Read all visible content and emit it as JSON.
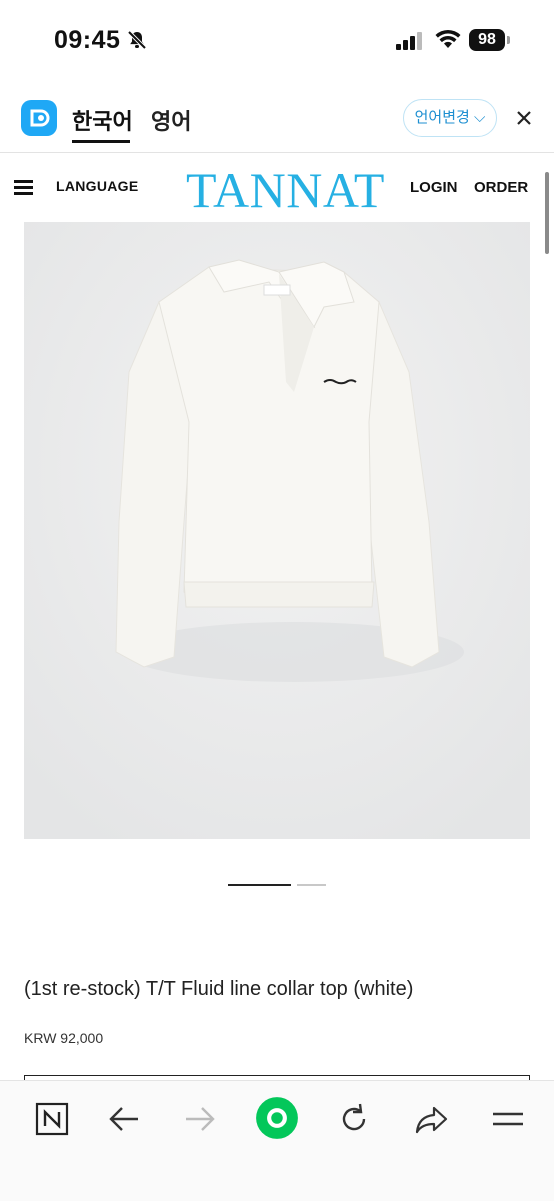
{
  "status_bar": {
    "time": "09:45",
    "battery": "98"
  },
  "translate_bar": {
    "korean_tab": "한국어",
    "english_tab": "영어",
    "change_language_button": "언어변경 ⌵"
  },
  "header": {
    "language": "LANGUAGE",
    "logo": "TANNAT",
    "login": "LOGIN",
    "order": "ORDER"
  },
  "product": {
    "title": "(1st re-stock) T/T Fluid line collar top (white)",
    "price": "KRW 92,000"
  },
  "toolbar_icons": [
    "naver-n-icon",
    "back-arrow-icon",
    "forward-arrow-icon",
    "green-dot-icon",
    "reload-icon",
    "share-icon",
    "hamburger-menu-icon"
  ],
  "colors": {
    "brand": "#26b0e3",
    "papago": "#1fa8f5",
    "green": "#03c75a"
  }
}
